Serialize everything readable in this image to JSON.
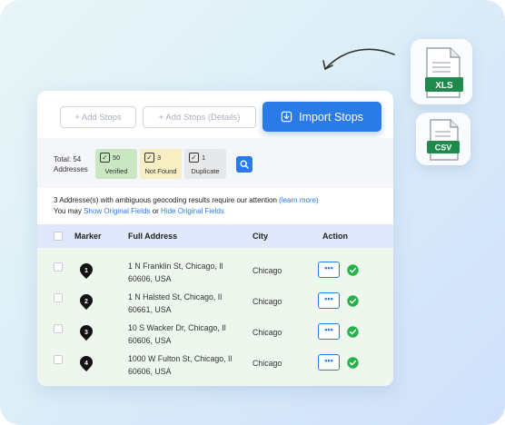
{
  "toolbar": {
    "add_stops_label": "+ Add Stops",
    "add_stops_details_label": "+ Add Stops (Details)",
    "import_stops_label": "Import Stops"
  },
  "files": {
    "xls_label": "XLS",
    "csv_label": "CSV"
  },
  "summary": {
    "total_line1": "Total: 54",
    "total_line2": "Addresses",
    "verified_count": "50",
    "verified_label": "Verified",
    "not_found_count": "3",
    "not_found_label": "Not Found",
    "duplicate_count": "1",
    "duplicate_label": "Duplicate"
  },
  "notice": {
    "line1": "3 Addresse(s) with ambiguous geocoding results require our attention",
    "learn_more": "(learn more)",
    "line2_prefix": "You may",
    "show_original": "Show Original Fields",
    "or": "or",
    "hide_original": "Hide Original Fields"
  },
  "table": {
    "headers": {
      "marker": "Marker",
      "address": "Full Address",
      "city": "City",
      "action": "Action"
    },
    "rows": [
      {
        "marker": "1",
        "address_line1": "1 N Franklin St, Chicago, Il",
        "address_line2": "60606, USA",
        "city": "Chicago",
        "more": "•••"
      },
      {
        "marker": "2",
        "address_line1": "1 N Halsted St, Chicago, Il",
        "address_line2": "60661, USA",
        "city": "Chicago",
        "more": "•••"
      },
      {
        "marker": "3",
        "address_line1": "10 S Wacker Dr, Chicago, Il",
        "address_line2": "60606, USA",
        "city": "Chicago",
        "more": "•••"
      },
      {
        "marker": "4",
        "address_line1": "1000 W Fulton St, Chicago, Il",
        "address_line2": "60606, USA",
        "city": "Chicago",
        "more": "•••"
      }
    ]
  },
  "colors": {
    "accent": "#2a7be8",
    "verified": "#c9e8c1",
    "not_found": "#f7efc3",
    "duplicate": "#e7e8ea",
    "success": "#27b14a",
    "xls": "#1f8a4c",
    "csv": "#1f8a4c"
  }
}
